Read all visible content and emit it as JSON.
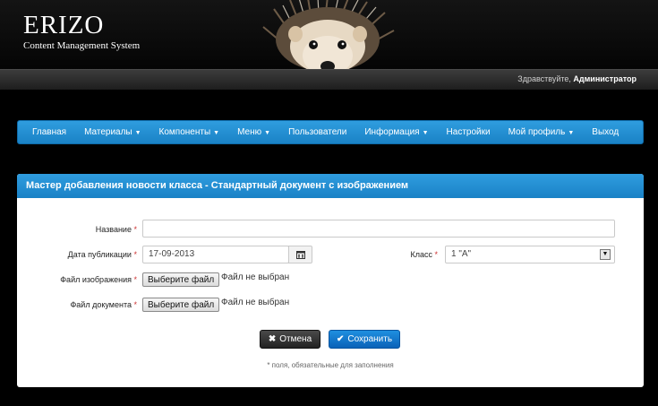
{
  "header": {
    "brand_title": "ERIZO",
    "brand_subtitle": "Content Management System",
    "greeting": "Здравствуйте,",
    "user": "Администратор"
  },
  "nav": {
    "items": [
      {
        "label": "Главная"
      },
      {
        "label": "Материалы",
        "caret": "▼"
      },
      {
        "label": "Компоненты",
        "caret": "▼"
      },
      {
        "label": "Меню",
        "caret": "▼"
      },
      {
        "label": "Пользователи"
      },
      {
        "label": "Информация",
        "caret": "▼"
      },
      {
        "label": "Настройки"
      },
      {
        "label": "Мой профиль",
        "caret": "▼"
      },
      {
        "label": "Выход"
      }
    ]
  },
  "form": {
    "title": "Мастер добавления новости класса - Стандартный документ с изображением",
    "name_label": "Название",
    "name_value": "",
    "date_label": "Дата публикации",
    "date_value": "17-09-2013",
    "class_label": "Класс",
    "class_value": "1 \"А\"",
    "image_label": "Файл изображения",
    "doc_label": "Файл документа",
    "choose_file": "Выберите файл",
    "no_file": "Файл не выбран",
    "required_mark": "*",
    "cancel_label": "Отмена",
    "save_label": "Сохранить",
    "footnote": "* поля, обязательные для заполнения"
  },
  "colors": {
    "accent": "#1a82c6",
    "cancel": "#2a2a2a",
    "save": "#0a62b8"
  },
  "icons": {
    "mascot": "hedgehog",
    "date_addon": "calendar-icon",
    "cancel": "close-icon",
    "save": "check-icon",
    "nav_caret": "chevron-down-icon"
  }
}
